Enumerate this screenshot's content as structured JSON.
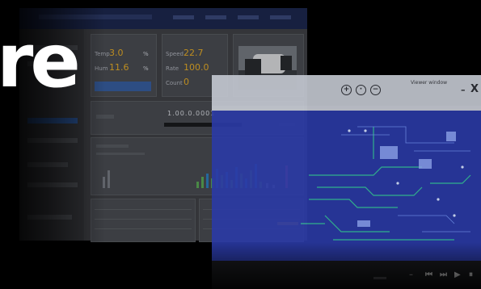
{
  "headline": {
    "text": "re"
  },
  "dashboard": {
    "metric_a_label": "Temp",
    "metric_a_value": "3.0",
    "metric_b_label": "Hum",
    "metric_b_value": "11.6",
    "metric_c_label": "Speed",
    "metric_c_value": "22.7",
    "metric_d_label": "Rate",
    "metric_d_value": "100.0",
    "metric_e_label": "Count",
    "metric_e_value": "0",
    "status_value": "1.00.0.0001",
    "unit_a": "%",
    "unit_b": "%"
  },
  "viewer": {
    "title": "Viewer window",
    "zoom_in_icon": "zoom-in-icon",
    "zoom_fit_icon": "zoom-fit-icon",
    "zoom_out_icon": "zoom-out-icon",
    "close_label": "X",
    "minimize_label": "–"
  },
  "colors": {
    "pcb_board": "#2a3aa8",
    "trace_green": "#38d39a",
    "accent_orange": "#f2b52a",
    "dashboard_header": "#1e2a52"
  }
}
